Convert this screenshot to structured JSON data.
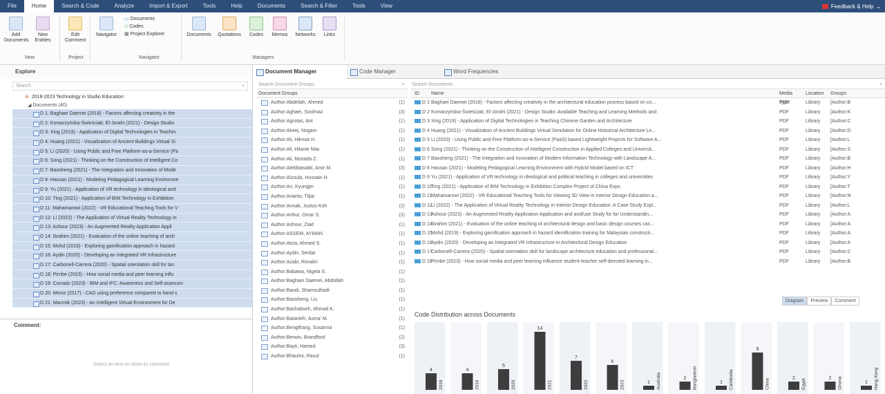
{
  "menubar": {
    "tabs": [
      "File",
      "Home",
      "Search & Code",
      "Analyze",
      "Import & Export",
      "Tools",
      "Help",
      "Documents",
      "Search & Filter",
      "Tools",
      "View"
    ],
    "active": 1,
    "feedback": "Feedback & Help"
  },
  "ribbon": {
    "add": "Add\nDocuments",
    "new": "New\nEntities",
    "edit": "Edit\nComment",
    "navigator": "Navigator",
    "nav_items": [
      "Documents",
      "Codes",
      "Project Explorer"
    ],
    "managers": [
      "Documents",
      "Quotations",
      "Codes",
      "Memos",
      "Networks",
      "Links"
    ],
    "groups": [
      "New",
      "Project",
      "Navigator",
      "Managers"
    ]
  },
  "explore": {
    "title": "Explore",
    "search": "Search",
    "project": "2018-2023 Technology in Studio Education",
    "docs_label": "Documents (40)",
    "items": [
      "D 1: Baghaei Daemei (2018) - Factors affecting creativity in the",
      "D 2: Komarzyńska-Świeściak; El-Jorahi (2021) - Design Studio",
      "D 3: Xing (2019) - Application of Digital Technologies in Teachin",
      "D 4: Huang (2021) - Visualization of Ancient Buildings Virtual Si",
      "D 5: Li (2020) - Using Public and Free Platform-as-a-Service (Pa",
      "D 6: Song (2021) - Thinking on the Construction of Intelligent Co",
      "D 7: Baosheng (2021) - The Integration and Innovation of Mode",
      "D 8: Hassan (2021) - Modeling Pedagogical Learning Environme",
      "D 9: Yu (2021) - Application of VR technology in ideological and",
      "D 10: Ting (2021) - Application of BIM Technology in Exhibition",
      "D 11: Mahamarowi (2022) - VR Educational Teaching Tools for V",
      "D 12: Li (2022) - The Application of Virtual Reality Technology in",
      "D 13: Ashour (2023) - An Augmented Reality Application Appli",
      "D 14: Ibrahim (2021) - Evaluation of the online teaching of arch",
      "D 15: Mohd (2019) - Exploring gamification approach in hazard",
      "D 16: Aydin (2020) - Developing an Integrated VR Infrastructure",
      "D 17: Carbonell-Carrera (2020) - Spatial orientation skill for lan",
      "D 18: Pirnbe (2023) - How social media and peer learning influ",
      "D 19: Corradz (2023) - BIM and IFC: Awareness and Self-assessm",
      "D 20: Meniz (2017) - CAD using preference compared to hand s",
      "D 21: Marznik (2023) - An Intelligent Virtual Environment for De"
    ]
  },
  "comment": {
    "title": "Comment:",
    "placeholder": "Select an item to show its comment"
  },
  "tabs": [
    "Document Manager",
    "Code Manager",
    "Word Frequencies"
  ],
  "groups": {
    "search": "Search Document Groups",
    "header": "Document Groups",
    "rows": [
      [
        "Author:Abdellah, Ahmed",
        "(1)"
      ],
      [
        "Author:Aghaei, Soolmaz",
        "(3)"
      ],
      [
        "Author:Agrotas, Ant",
        "(1)"
      ],
      [
        "Author:Akeej, Nogam",
        "(1)"
      ],
      [
        "Author:Ali, Hikmat H.",
        "(1)"
      ],
      [
        "Author:Ali, Hilanie Nita",
        "(1)"
      ],
      [
        "Author:Ali, Mostafa Z.",
        "(1)"
      ],
      [
        "Author:Alebbiasiabi, Amir M.",
        "(3)"
      ],
      [
        "Author:Alzoubi, Hussain H.",
        "(1)"
      ],
      [
        "Author:An, Kyungjin",
        "(1)"
      ],
      [
        "Author:Arianto, Tiljat",
        "(1)"
      ],
      [
        "Author:Armak, Justus Koh",
        "(2)"
      ],
      [
        "Author:Arthur, Omar S.",
        "(3)"
      ],
      [
        "Author:Ashour, Ziad",
        "(1)"
      ],
      [
        "Author:ASSEM, AYMAN",
        "(1)"
      ],
      [
        "Author:Atzia, Ahmed S.",
        "(1)"
      ],
      [
        "Author:Aydin, Serdar",
        "(1)"
      ],
      [
        "Author:Azabi, Rovakri",
        "(1)"
      ],
      [
        "Author:Babawa, Nigela S.",
        "(1)"
      ],
      [
        "Author:Baghaei Daemei, Abdollah",
        "(1)"
      ],
      [
        "Author:Bandi, Shamsulhadi",
        "(1)"
      ],
      [
        "Author:Baosheng, Liu",
        "(1)"
      ],
      [
        "Author:Bashabseh, Ahmad K.",
        "(1)"
      ],
      [
        "Author:Batanieh, Asma' M.",
        "(1)"
      ],
      [
        "Author:Bengtfrang, Susanna",
        "(1)"
      ],
      [
        "Author:Berwin, Brandford",
        "(2)"
      ],
      [
        "Author:Bayti, Hamed",
        "(3)"
      ],
      [
        "Author:Bhaulmi, Rasul",
        "(1)"
      ]
    ]
  },
  "docs": {
    "search": "Search Documents",
    "headers": [
      "ID",
      "Name",
      "Media Type",
      "Location",
      "Groups"
    ],
    "rows": [
      [
        "D 1",
        "Baghaei Daemei (2018) - Factors affecting creativity in the architectural education process based on co...",
        "PDF",
        "Library",
        "[Author:B"
      ],
      [
        "D 2",
        "Komarzyńska-Świeściak; El-Jorahi (2021) - Design Studio: Available Teaching and Learning Methods and",
        "PDF",
        "Library",
        "[Author:K"
      ],
      [
        "D 3",
        "Xing (2019) - Application of Digital Technologies in Teaching Chinese Garden and Architecture",
        "PDF",
        "Library",
        "[Author:C"
      ],
      [
        "D 4",
        "Huang (2021) - Visualization of Ancient Buildings Virtual Simulation for Online Historical Architecture Le...",
        "PDF",
        "Library",
        "[Author:D"
      ],
      [
        "D 5",
        "Li (2020) - Using Public and Free Platform-as-a-Service (PaaS) based Lightweight Projects for Software A...",
        "PDF",
        "Library",
        "[Author:L"
      ],
      [
        "D 6",
        "Song (2021) - Thinking on the Construction of Intelligent Construction in Applied Colleges and Universit...",
        "PDF",
        "Library",
        "[Author:S"
      ],
      [
        "D 7",
        "Baosheng (2021) - The Integration and Innovation of Modern Information Technology with Landscape A...",
        "PDF",
        "Library",
        "[Author:B"
      ],
      [
        "D 8",
        "Hassan (2021) - Modeling Pedagogical Learning Environment with Hybrid Model based on ICT",
        "PDF",
        "Library",
        "[Author:H"
      ],
      [
        "D 9",
        "Yu (2021) - Application of VR technology in ideological and political teaching in colleges and universities",
        "PDF",
        "Library",
        "[Author:Y"
      ],
      [
        "D 10",
        "Ting (2021) - Application of BIM Technology in Exhibition Complex Project of China Expo",
        "PDF",
        "Library",
        "[Author:T"
      ],
      [
        "D 11",
        "Mahamarowi (2022) - VR Educational Teaching Tools for Viewing 3D View in Interior Design Education a...",
        "PDF",
        "Library",
        "[Author:N"
      ],
      [
        "D 12",
        "Li (2022) - The Application of Virtual Reality Technology in Interior Design Education: A Case Study Expl...",
        "PDF",
        "Library",
        "[Author:L"
      ],
      [
        "D 13",
        "Ashour (2023) - An Augmented Reality Application Application and and/use Study for for Understandin...",
        "PDF",
        "Library",
        "[Author:A"
      ],
      [
        "D 14",
        "Ibrahim (2021) - Evaluation of the online teaching of architectural design and basic design courses cas...",
        "PDF",
        "Library",
        "[Author:A"
      ],
      [
        "D 15",
        "Mohd (2019) - Exploring gamification approach in hazard identification training for Malaysian constructi...",
        "PDF",
        "Library",
        "[Author:A"
      ],
      [
        "D 16",
        "Aydin (2020) - Developing an Integrated VR Infrastructure in Architectural Design Education",
        "PDF",
        "Library",
        "[Author:A"
      ],
      [
        "D 17",
        "Carbonell-Carrera (2020) - Spatial orientation skill for landscape architecture education and professional...",
        "PDF",
        "Library",
        "[Author:C"
      ],
      [
        "D 18",
        "Pirnbe (2023) - How social media and peer learning influence student-teacher self-directed learning in...",
        "PDF",
        "Library",
        "[Author:B"
      ]
    ]
  },
  "view_buttons": [
    "Diagram",
    "Preview",
    "Comment"
  ],
  "chart_data": {
    "type": "bar",
    "title": "Code Distribution across Documents",
    "categories": [
      "2018",
      "2019",
      "2020",
      "2021",
      "2022",
      "2023",
      "Australia",
      "Bangladesh",
      "Cambodia",
      "China",
      "Egypt",
      "Ghana",
      "Hong Kong"
    ],
    "values": [
      4,
      4,
      5,
      14,
      7,
      6,
      1,
      2,
      1,
      9,
      2,
      2,
      1
    ]
  }
}
